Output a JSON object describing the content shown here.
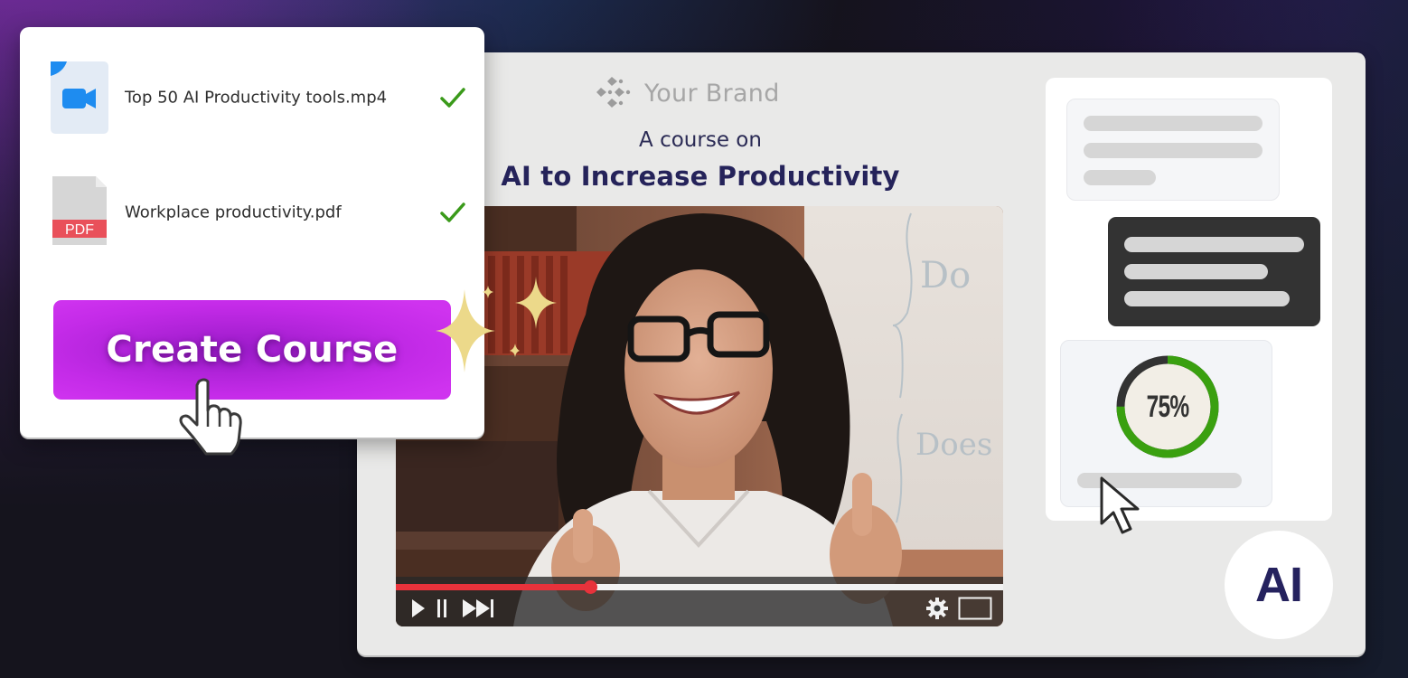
{
  "colors": {
    "accent_purple": "#c42be8",
    "title_navy": "#25235a",
    "progress_red": "#e8323b",
    "ring_green": "#3aa010",
    "ring_track": "#333333",
    "check_green": "#3a9a1a"
  },
  "upload_card": {
    "files": [
      {
        "icon": "video-file-icon",
        "name": "Top 50 AI Productivity tools.mp4",
        "status_icon": "check-icon"
      },
      {
        "icon": "pdf-file-icon",
        "name": "Workplace productivity.pdf",
        "status_icon": "check-icon",
        "badge": "PDF"
      }
    ],
    "create_button_label": "Create Course"
  },
  "course": {
    "brand_name": "Your Brand",
    "subtitle": "A course on",
    "title": "AI to Increase Productivity"
  },
  "video": {
    "progress_fraction": 0.32,
    "controls": [
      "play-icon",
      "pause-icon",
      "skip-next-icon",
      "settings-icon",
      "fullscreen-icon"
    ],
    "whiteboard_text": [
      "Do",
      "Does"
    ]
  },
  "side_panel": {
    "progress_percent": 75,
    "progress_label": "75%"
  },
  "ai_badge": "AI"
}
